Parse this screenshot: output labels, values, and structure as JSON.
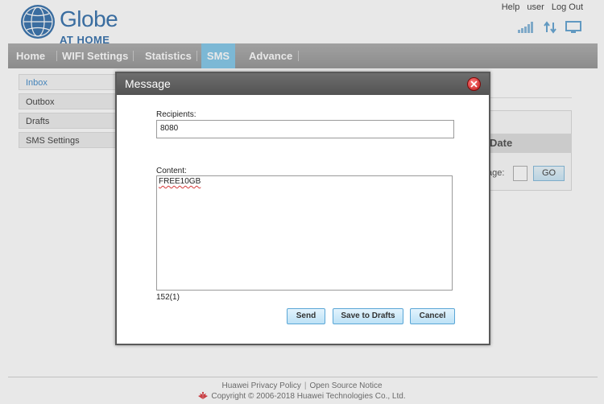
{
  "brand": {
    "name": "Globe",
    "sub": "AT HOME"
  },
  "top_links": [
    "Help",
    "user",
    "Log Out"
  ],
  "nav": {
    "items": [
      {
        "label": "Home"
      },
      {
        "label": "WIFI Settings"
      },
      {
        "label": "Statistics"
      },
      {
        "label": "SMS",
        "active": true
      },
      {
        "label": "Advance"
      }
    ]
  },
  "sidebar": {
    "items": [
      {
        "label": "Inbox",
        "active": true
      },
      {
        "label": "Outbox"
      },
      {
        "label": "Drafts"
      },
      {
        "label": "SMS Settings"
      }
    ]
  },
  "background": {
    "date_header": "Date",
    "page_label": "age:",
    "go_label": "GO"
  },
  "dialog": {
    "title": "Message",
    "recipients_label": "Recipients:",
    "recipients_value": "8080",
    "content_label": "Content:",
    "content_value": "FREE10GB",
    "char_count": "152(1)",
    "buttons": {
      "send": "Send",
      "save": "Save to Drafts",
      "cancel": "Cancel"
    }
  },
  "footer": {
    "privacy": "Huawei Privacy Policy",
    "open_source": "Open Source Notice",
    "copyright": "Copyright © 2006-2018 Huawei Technologies Co., Ltd."
  },
  "colors": {
    "brand_blue": "#2b6aa8",
    "nav_active": "#7cc5e8",
    "button_border": "#5aa6d6"
  }
}
